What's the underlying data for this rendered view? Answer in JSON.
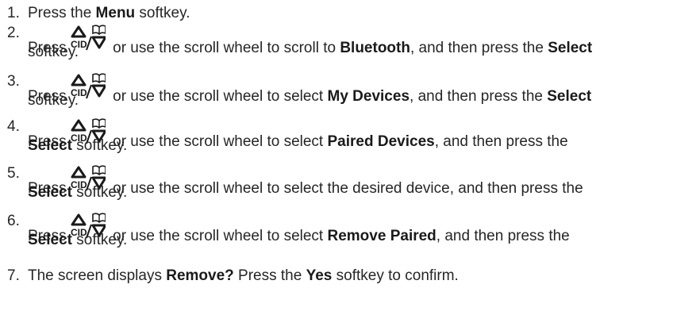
{
  "steps": [
    {
      "number": "1.",
      "lines": [
        [
          {
            "t": "Press the "
          },
          {
            "b": "Menu"
          },
          {
            "t": " softkey."
          }
        ]
      ]
    },
    {
      "number": "2.",
      "icon": true,
      "lines": [
        [
          {
            "t": "Press "
          },
          {
            "icon": "cid-scroll-icon"
          },
          {
            "t": " or use the scroll wheel to scroll to "
          },
          {
            "b": "Bluetooth"
          },
          {
            "t": ", and then press the "
          },
          {
            "b": "Select"
          }
        ],
        [
          {
            "t": "softkey."
          }
        ]
      ]
    },
    {
      "number": "3.",
      "lines": [
        [
          {
            "t": "Press "
          },
          {
            "icon": "cid-scroll-icon"
          },
          {
            "t": " or use the scroll wheel to select "
          },
          {
            "b": "My Devices"
          },
          {
            "t": ", and then press the "
          },
          {
            "b": "Select"
          }
        ],
        [
          {
            "t": "softkey."
          }
        ]
      ]
    },
    {
      "number": "4.",
      "lines": [
        [
          {
            "t": "Press "
          },
          {
            "icon": "cid-scroll-icon"
          },
          {
            "t": " or use the scroll wheel to select "
          },
          {
            "b": "Paired Devices"
          },
          {
            "t": ", and then press the"
          }
        ],
        [
          {
            "b": "Select"
          },
          {
            "t": " softkey."
          }
        ]
      ]
    },
    {
      "number": "5.",
      "lines": [
        [
          {
            "t": "Press "
          },
          {
            "icon": "cid-scroll-icon"
          },
          {
            "t": " or use the scroll wheel to select the desired device, and then press the"
          }
        ],
        [
          {
            "b": "Select"
          },
          {
            "t": " softkey."
          }
        ]
      ]
    },
    {
      "number": "6.",
      "lines": [
        [
          {
            "t": "Press "
          },
          {
            "icon": "cid-scroll-icon"
          },
          {
            "t": " or use the scroll wheel to select "
          },
          {
            "b": "Remove Paired"
          },
          {
            "t": ", and then press the"
          }
        ],
        [
          {
            "b": "Select"
          },
          {
            "t": " softkey."
          }
        ]
      ]
    },
    {
      "number": "7.",
      "lines": [
        [
          {
            "t": "The screen displays "
          },
          {
            "b": "Remove?"
          },
          {
            "t": " Press the "
          },
          {
            "b": "Yes"
          },
          {
            "t": " softkey to confirm."
          }
        ]
      ]
    }
  ],
  "icon_glyphs": {
    "cid_label": "CID",
    "separator": "/"
  }
}
